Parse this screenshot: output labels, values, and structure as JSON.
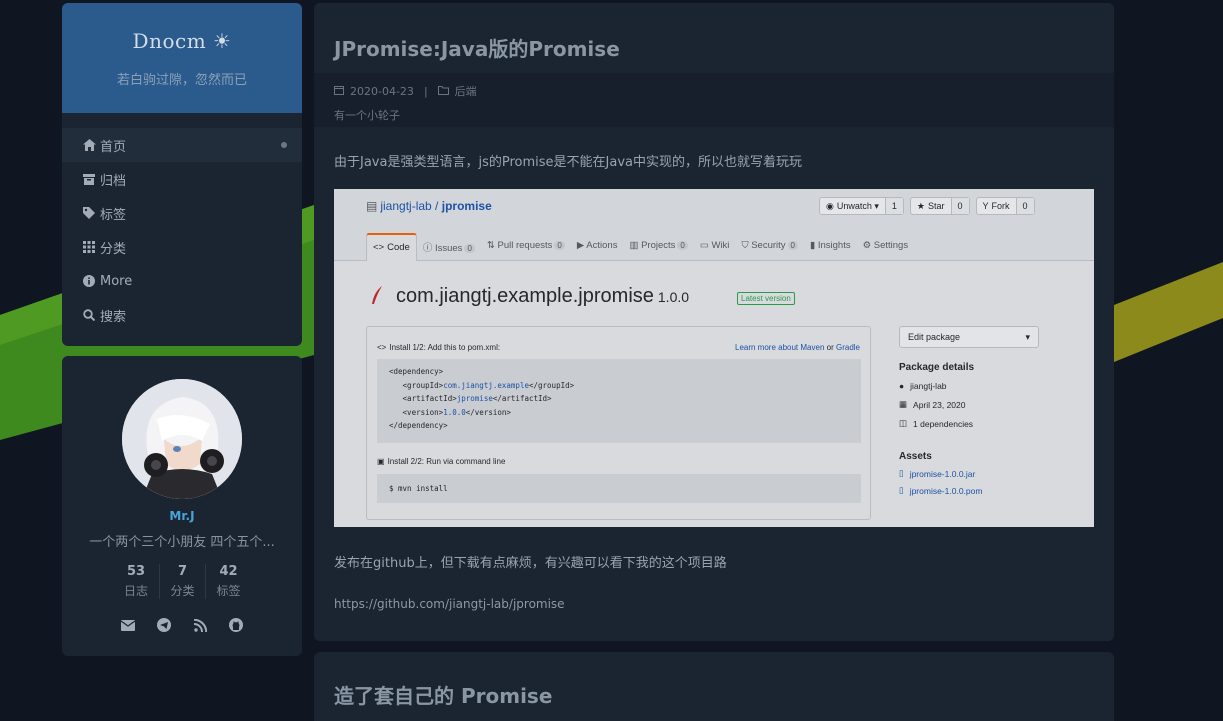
{
  "colors": {
    "bg": "#0f1621",
    "panel": "#1b2532",
    "brand": "#2b5a8c",
    "accent_green": "#3f8a1f",
    "accent_yellow": "#8c8a1a",
    "author_name": "#4aa3d8"
  },
  "site": {
    "title": "Dnocm ☀",
    "subtitle": "若白驹过隙，忽然而已"
  },
  "menu": [
    {
      "label": "首页",
      "icon": "home-icon",
      "active": true
    },
    {
      "label": "归档",
      "icon": "archive-icon"
    },
    {
      "label": "标签",
      "icon": "tags-icon"
    },
    {
      "label": "分类",
      "icon": "grid-icon"
    },
    {
      "label": "More",
      "icon": "info-icon"
    },
    {
      "label": "搜索",
      "icon": "search-icon"
    }
  ],
  "author": {
    "name": "Mr.J",
    "description": "一个两个三个小朋友 四个五个...",
    "stats": [
      {
        "num": "53",
        "label": "日志"
      },
      {
        "num": "7",
        "label": "分类"
      },
      {
        "num": "42",
        "label": "标签"
      }
    ],
    "links": [
      "mail-icon",
      "telegram-icon",
      "rss-icon",
      "github-icon"
    ]
  },
  "post1": {
    "title": "JPromise:Java版的Promise",
    "date": "2020-04-23",
    "category": "后端",
    "description": "有一个小轮子",
    "paragraph1": "由于Java是强类型语言，js的Promise是不能在Java中实现的，所以也就写着玩玩",
    "paragraph2": "发布在github上，但下载有点麻烦，有兴趣可以看下我的这个项目路",
    "link": "https://github.com/jiangtj-lab/jpromise",
    "screenshot": {
      "owner": "jiangtj-lab",
      "repo": "jpromise",
      "buttons": [
        {
          "label": "Unwatch ▾",
          "count": "1",
          "icon": "eye-icon"
        },
        {
          "label": "Star",
          "count": "0",
          "icon": "star-icon"
        },
        {
          "label": "Fork",
          "count": "0",
          "icon": "fork-icon"
        }
      ],
      "tabs": [
        {
          "label": "Code",
          "count": ""
        },
        {
          "label": "Issues",
          "count": "0"
        },
        {
          "label": "Pull requests",
          "count": "0"
        },
        {
          "label": "Actions",
          "count": ""
        },
        {
          "label": "Projects",
          "count": "0"
        },
        {
          "label": "Wiki",
          "count": ""
        },
        {
          "label": "Security",
          "count": "0"
        },
        {
          "label": "Insights",
          "count": ""
        },
        {
          "label": "Settings",
          "count": ""
        }
      ],
      "package_name": "com.jiangtj.example.jpromise",
      "package_version": "1.0.0",
      "badge": "Latest version",
      "install1": "Install 1/2: Add this to pom.xml:",
      "learn_more": "Learn more about Maven",
      "or": "or",
      "gradle": "Gradle",
      "code_lines": [
        {
          "pre": "<dependency>",
          "val": "",
          "post": ""
        },
        {
          "pre": "  <groupId>",
          "val": "com.jiangtj.example",
          "post": "</groupId>"
        },
        {
          "pre": "  <artifactId>",
          "val": "jpromise",
          "post": "</artifactId>"
        },
        {
          "pre": "  <version>",
          "val": "1.0.0",
          "post": "</version>"
        },
        {
          "pre": "</dependency>",
          "val": "",
          "post": ""
        }
      ],
      "install2": "Install 2/2: Run via command line",
      "command": "$ mvn install",
      "edit_package": "Edit package",
      "package_details": "Package details",
      "detail_owner": "jiangtj-lab",
      "detail_date": "April 23, 2020",
      "detail_deps": "1 dependencies",
      "assets": "Assets",
      "asset_files": [
        "jpromise-1.0.0.jar",
        "jpromise-1.0.0.pom"
      ]
    }
  },
  "post2": {
    "title": "造了套自己的 Promise"
  }
}
